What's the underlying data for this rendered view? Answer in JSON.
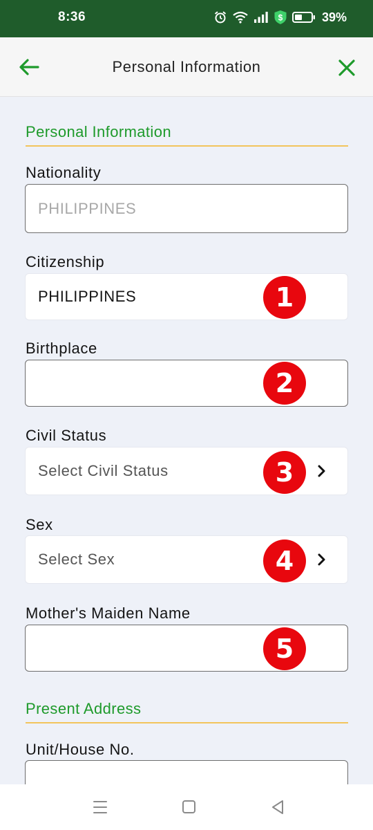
{
  "status_bar": {
    "time": "8:36",
    "battery_percent": "39%",
    "icons": [
      "alarm-icon",
      "wifi-icon",
      "signal-icon",
      "shield-dollar-icon",
      "battery-icon"
    ]
  },
  "app_bar": {
    "title": "Personal Information",
    "back_icon": "arrow-left-icon",
    "close_icon": "close-icon",
    "accent_color": "#1e9a2b"
  },
  "form": {
    "section_personal": "Personal Information",
    "fields": {
      "nationality": {
        "label": "Nationality",
        "placeholder": "PHILIPPINES"
      },
      "citizenship": {
        "label": "Citizenship",
        "value": "PHILIPPINES",
        "badge": "1"
      },
      "birthplace": {
        "label": "Birthplace",
        "value": "",
        "badge": "2"
      },
      "civil_status": {
        "label": "Civil Status",
        "placeholder": "Select Civil Status",
        "badge": "3"
      },
      "sex": {
        "label": "Sex",
        "placeholder": "Select Sex",
        "badge": "4"
      },
      "mothers_maiden_name": {
        "label": "Mother's Maiden Name",
        "value": "",
        "badge": "5"
      }
    },
    "section_address": "Present Address",
    "unit_house_no": {
      "label": "Unit/House No.",
      "value": ""
    }
  },
  "colors": {
    "status_bar": "#1f5c2b",
    "section_underline": "#f2c45b",
    "badge": "#e8070e",
    "background": "#eef1f8"
  },
  "nav_bar": {
    "icons": [
      "menu-icon",
      "home-square-icon",
      "back-triangle-icon"
    ]
  }
}
